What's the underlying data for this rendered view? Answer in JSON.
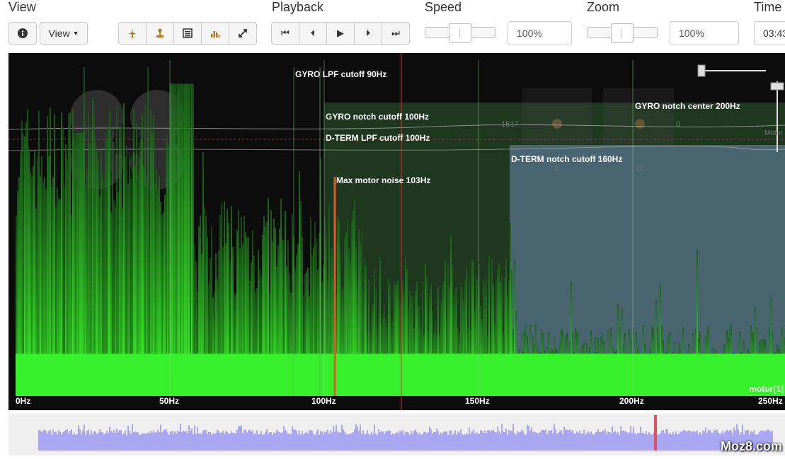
{
  "toolbar": {
    "view_title": "View",
    "playback_title": "Playback",
    "speed_title": "Speed",
    "zoom_title": "Zoom",
    "time_title": "Time",
    "view_dropdown_label": "View",
    "speed_value": "100%",
    "zoom_value": "100%",
    "time_value": "03:43",
    "speed_level": 0.5,
    "zoom_level": 0.5
  },
  "graph": {
    "freq_ticks": [
      "0Hz",
      "50Hz",
      "100Hz",
      "150Hz",
      "200Hz",
      "250Hz"
    ],
    "overlays": {
      "gyro_lpf": "GYRO LPF cutoff 90Hz",
      "gyro_notch_cutoff": "GYRO notch cutoff 100Hz",
      "dterm_lpf": "D-TERM LPF cutoff 100Hz",
      "max_motor_noise": "Max motor noise 103Hz",
      "dterm_notch_cutoff": "D-TERM notch cutoff 160Hz",
      "gyro_notch_center": "GYRO notch center 200Hz"
    },
    "faint_values": [
      "1517",
      "0",
      "0",
      "0"
    ],
    "faint_motor_label": "Motor",
    "series_label": "motor[1]",
    "colors": {
      "spectrum": "#33ee22",
      "marker": "#e05a2a",
      "notch_box": "#6b8cb0"
    }
  },
  "watermark": "Moz8.com"
}
